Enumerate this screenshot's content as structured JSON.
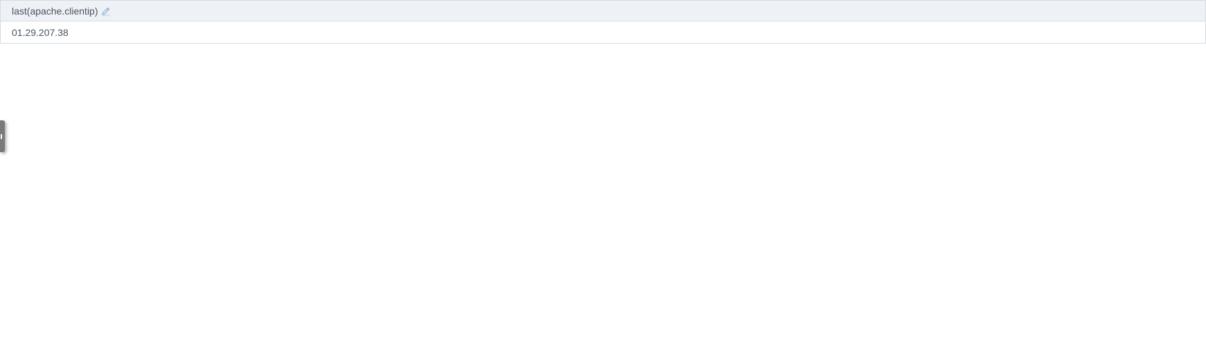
{
  "table": {
    "column_header": "last(apache.clientip)",
    "edit_icon": "pencil-icon",
    "rows": [
      {
        "value": "01.29.207.38"
      }
    ]
  },
  "side_handle": {
    "icon": "drag-handle-icon"
  },
  "colors": {
    "header_bg": "#eef1f5",
    "border": "#d6dbe1",
    "text": "#4a5563",
    "icon_accent": "#8fb3d9",
    "handle": "#7a7a7a"
  }
}
